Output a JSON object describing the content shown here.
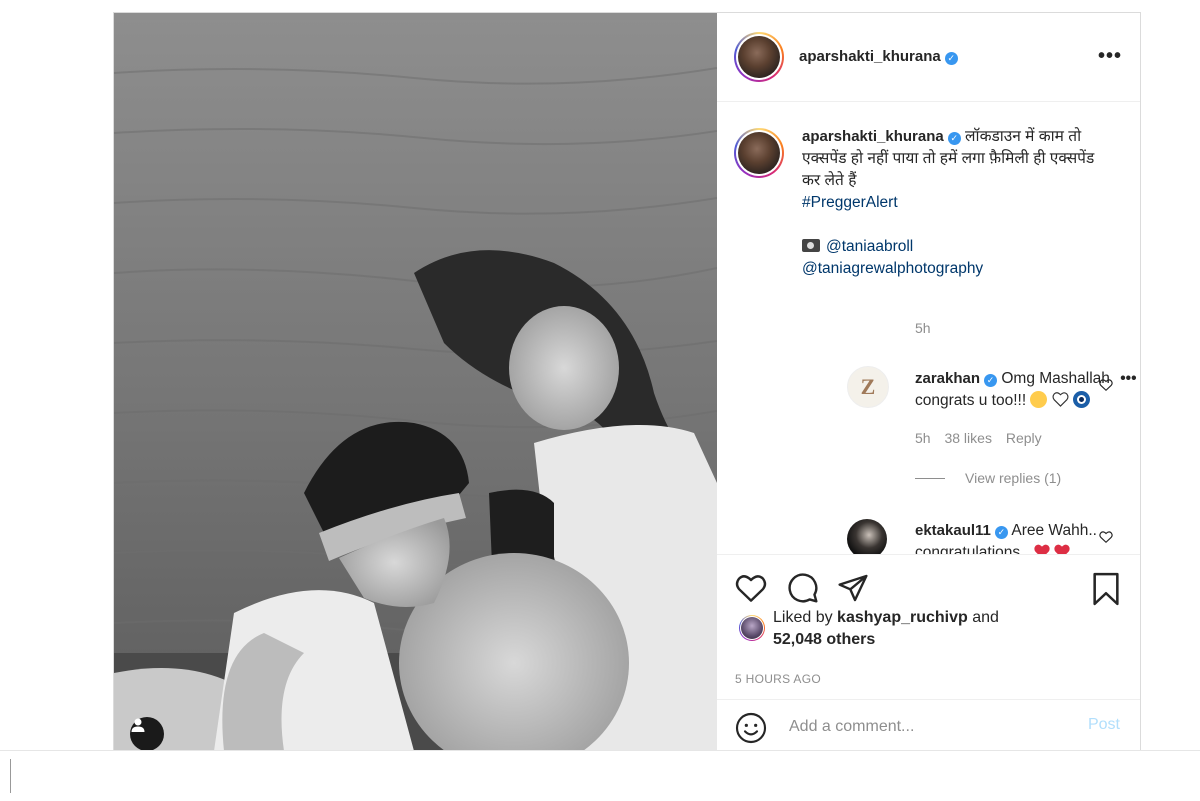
{
  "post": {
    "author": "aparshakti_khurana",
    "verified_mark": "✓",
    "more_label": "•••"
  },
  "caption": {
    "username": "aparshakti_khurana",
    "text": "लॉकडाउन में काम तो एक्सपेंड हो नहीं पाया तो हमें लगा फ़ैमिली ही एक्सपेंड कर लेते हैं",
    "hashtag": "#PreggerAlert",
    "camera_icon": "camera-icon",
    "credit1": "@taniaabroll",
    "credit2": "@taniagrewalphotography",
    "time": "5h"
  },
  "comments": [
    {
      "username": "zarakhan",
      "avatar_letter": "Z",
      "text_line1": "Omg Mashallah",
      "ellipsis": "•••",
      "text_line2": "congrats u too!!! ",
      "emojis": [
        "hugging-face",
        "white-heart",
        "nazar-amulet"
      ],
      "time": "5h",
      "likes": "38 likes",
      "reply": "Reply",
      "view_replies": "View replies (1)"
    },
    {
      "username": "ektakaul11",
      "text_line1": "Aree Wahh..",
      "text_line2": "congratulations.. ",
      "emojis": [
        "red-heart",
        "red-heart"
      ]
    }
  ],
  "likes": {
    "prefix": "Liked by ",
    "liker": "kashyap_ruchivp",
    "connector": " and",
    "count": "52,048 others"
  },
  "timestamp": "5 HOURS AGO",
  "add_comment": {
    "placeholder": "Add a comment...",
    "post_label": "Post"
  },
  "colors": {
    "verified": "#3897f0",
    "link": "#00376b",
    "muted": "#8e8e8e",
    "post_disabled": "#b2dffc",
    "heart_red": "#ed4956"
  }
}
